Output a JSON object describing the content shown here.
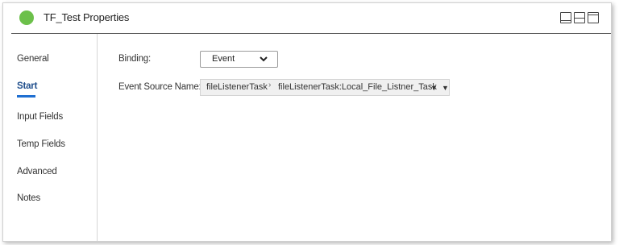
{
  "window": {
    "title": "TF_Test Properties",
    "status_color": "#6cc04a",
    "layout_icons": [
      "layout-bottom-panel-icon",
      "layout-split-icon",
      "layout-top-panel-icon"
    ]
  },
  "sidebar": {
    "items": [
      {
        "label": "General",
        "active": false
      },
      {
        "label": "Start",
        "active": true
      },
      {
        "label": "Input Fields",
        "active": false
      },
      {
        "label": "Temp Fields",
        "active": false
      },
      {
        "label": "Advanced",
        "active": false
      },
      {
        "label": "Notes",
        "active": false
      }
    ]
  },
  "form": {
    "binding_label": "Binding:",
    "binding_value": "Event",
    "event_source_label": "Event Source Name:",
    "event_source_task": "fileListenerTask",
    "event_source_separator": "›",
    "event_source_detail": "fileListenerTask:Local_File_Listner_Task"
  },
  "colors": {
    "accent": "#1f6fd1",
    "active_text": "#1f4e8c"
  }
}
